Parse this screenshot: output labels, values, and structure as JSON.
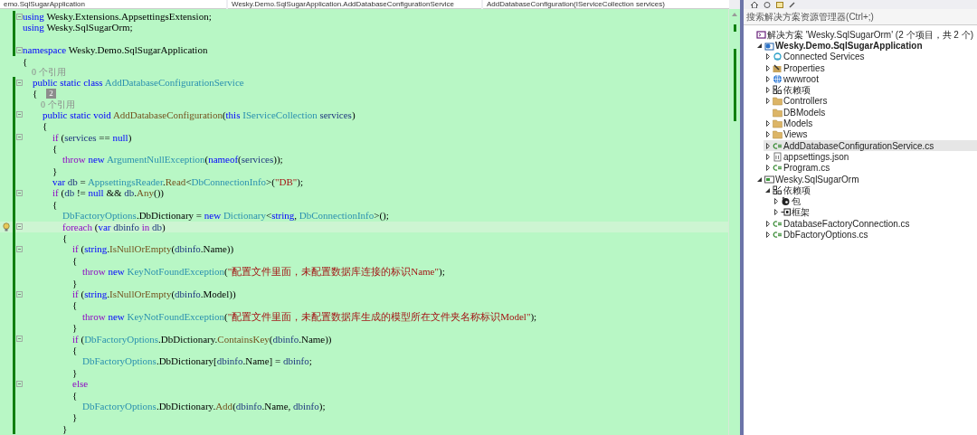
{
  "navigation_bar": [
    "emo.SqlSugarApplication",
    "Wesky.Demo.SqlSugarApplication.AddDatabaseConfigurationService",
    "AddDatabaseConfiguration(IServiceCollection services)"
  ],
  "editor": {
    "lines": [
      {
        "kind": "code",
        "changed": true,
        "foldable": true,
        "current": false,
        "tokens": [
          {
            "kind": "kw",
            "text": "using"
          },
          {
            "kind": "plain",
            "text": " Wesky.Extensions.AppsettingsExtension;"
          }
        ]
      },
      {
        "kind": "code",
        "changed": true,
        "foldable": false,
        "current": false,
        "tokens": [
          {
            "kind": "kw",
            "text": "using"
          },
          {
            "kind": "plain",
            "text": " Wesky.SqlSugarOrm;"
          }
        ]
      },
      {
        "kind": "blank",
        "changed": true,
        "foldable": false,
        "current": false
      },
      {
        "kind": "code",
        "changed": true,
        "foldable": true,
        "current": false,
        "tokens": [
          {
            "kind": "kw",
            "text": "namespace"
          },
          {
            "kind": "plain",
            "text": " Wesky.Demo.SqlSugarApplication"
          }
        ]
      },
      {
        "kind": "code",
        "changed": false,
        "foldable": false,
        "current": false,
        "tokens": [
          {
            "kind": "plain",
            "text": "{"
          }
        ]
      },
      {
        "kind": "codelens",
        "changed": false,
        "foldable": false,
        "current": false,
        "tokens": [
          {
            "kind": "lens",
            "text": "    0 个引用"
          }
        ]
      },
      {
        "kind": "code",
        "changed": true,
        "foldable": true,
        "current": false,
        "tokens": [
          {
            "kind": "kw",
            "text": "    public static class"
          },
          {
            "kind": "type",
            "text": " AddDatabaseConfigurationService"
          }
        ]
      },
      {
        "kind": "code",
        "changed": true,
        "foldable": false,
        "current": false,
        "tokens": [
          {
            "kind": "plain",
            "text": "    {"
          },
          {
            "kind": "badge",
            "text": "2"
          }
        ]
      },
      {
        "kind": "codelens",
        "changed": true,
        "foldable": false,
        "current": false,
        "tokens": [
          {
            "kind": "lens",
            "text": "        0 个引用"
          }
        ]
      },
      {
        "kind": "code",
        "changed": true,
        "foldable": true,
        "current": false,
        "tokens": [
          {
            "kind": "kw",
            "text": "        public static void"
          },
          {
            "kind": "method",
            "text": " AddDatabaseConfiguration"
          },
          {
            "kind": "plain",
            "text": "("
          },
          {
            "kind": "kw",
            "text": "this"
          },
          {
            "kind": "type",
            "text": " IServiceCollection"
          },
          {
            "kind": "ident",
            "text": " services"
          },
          {
            "kind": "plain",
            "text": ")"
          }
        ]
      },
      {
        "kind": "code",
        "changed": true,
        "foldable": false,
        "current": false,
        "tokens": [
          {
            "kind": "plain",
            "text": "        {"
          }
        ]
      },
      {
        "kind": "code",
        "changed": true,
        "foldable": true,
        "current": false,
        "tokens": [
          {
            "kind": "ctrl",
            "text": "            if"
          },
          {
            "kind": "plain",
            "text": " ("
          },
          {
            "kind": "ident",
            "text": "services"
          },
          {
            "kind": "plain",
            "text": " == "
          },
          {
            "kind": "kw",
            "text": "null"
          },
          {
            "kind": "plain",
            "text": ")"
          }
        ]
      },
      {
        "kind": "code",
        "changed": true,
        "foldable": false,
        "current": false,
        "tokens": [
          {
            "kind": "plain",
            "text": "            {"
          }
        ]
      },
      {
        "kind": "code",
        "changed": true,
        "foldable": false,
        "current": false,
        "tokens": [
          {
            "kind": "ctrl",
            "text": "                throw"
          },
          {
            "kind": "kw",
            "text": " new"
          },
          {
            "kind": "type",
            "text": " ArgumentNullException"
          },
          {
            "kind": "plain",
            "text": "("
          },
          {
            "kind": "kw",
            "text": "nameof"
          },
          {
            "kind": "plain",
            "text": "("
          },
          {
            "kind": "ident",
            "text": "services"
          },
          {
            "kind": "plain",
            "text": "));"
          }
        ]
      },
      {
        "kind": "code",
        "changed": true,
        "foldable": false,
        "current": false,
        "tokens": [
          {
            "kind": "plain",
            "text": "            }"
          }
        ]
      },
      {
        "kind": "code",
        "changed": true,
        "foldable": false,
        "current": false,
        "tokens": [
          {
            "kind": "kw",
            "text": "            var"
          },
          {
            "kind": "ident",
            "text": " db"
          },
          {
            "kind": "plain",
            "text": " = "
          },
          {
            "kind": "type",
            "text": "AppsettingsReader"
          },
          {
            "kind": "plain",
            "text": "."
          },
          {
            "kind": "method",
            "text": "Read"
          },
          {
            "kind": "plain",
            "text": "<"
          },
          {
            "kind": "type",
            "text": "DbConnectionInfo"
          },
          {
            "kind": "plain",
            "text": ">("
          },
          {
            "kind": "str",
            "text": "\"DB\""
          },
          {
            "kind": "plain",
            "text": ");"
          }
        ]
      },
      {
        "kind": "code",
        "changed": true,
        "foldable": true,
        "current": false,
        "tokens": [
          {
            "kind": "ctrl",
            "text": "            if"
          },
          {
            "kind": "plain",
            "text": " ("
          },
          {
            "kind": "ident",
            "text": "db"
          },
          {
            "kind": "plain",
            "text": " != "
          },
          {
            "kind": "kw",
            "text": "null"
          },
          {
            "kind": "plain",
            "text": " && "
          },
          {
            "kind": "ident",
            "text": "db"
          },
          {
            "kind": "plain",
            "text": "."
          },
          {
            "kind": "method",
            "text": "Any"
          },
          {
            "kind": "plain",
            "text": "())"
          }
        ]
      },
      {
        "kind": "code",
        "changed": true,
        "foldable": false,
        "current": false,
        "tokens": [
          {
            "kind": "plain",
            "text": "            {"
          }
        ]
      },
      {
        "kind": "code",
        "changed": true,
        "foldable": false,
        "current": false,
        "tokens": [
          {
            "kind": "type",
            "text": "                DbFactoryOptions"
          },
          {
            "kind": "plain",
            "text": ".DbDictionary = "
          },
          {
            "kind": "kw",
            "text": "new"
          },
          {
            "kind": "type",
            "text": " Dictionary"
          },
          {
            "kind": "plain",
            "text": "<"
          },
          {
            "kind": "kw",
            "text": "string"
          },
          {
            "kind": "plain",
            "text": ", "
          },
          {
            "kind": "type",
            "text": "DbConnectionInfo"
          },
          {
            "kind": "plain",
            "text": ">();"
          }
        ]
      },
      {
        "kind": "code",
        "changed": true,
        "foldable": true,
        "current": true,
        "tokens": [
          {
            "kind": "ctrl",
            "text": "                foreach"
          },
          {
            "kind": "plain",
            "text": " ("
          },
          {
            "kind": "kw",
            "text": "var"
          },
          {
            "kind": "ident",
            "text": " dbinfo"
          },
          {
            "kind": "ctrl",
            "text": " in"
          },
          {
            "kind": "ident",
            "text": " db"
          },
          {
            "kind": "plain",
            "text": ")"
          }
        ]
      },
      {
        "kind": "code",
        "changed": true,
        "foldable": false,
        "current": false,
        "tokens": [
          {
            "kind": "plain",
            "text": "                {"
          }
        ]
      },
      {
        "kind": "code",
        "changed": true,
        "foldable": true,
        "current": false,
        "tokens": [
          {
            "kind": "ctrl",
            "text": "                    if"
          },
          {
            "kind": "plain",
            "text": " ("
          },
          {
            "kind": "kw",
            "text": "string"
          },
          {
            "kind": "plain",
            "text": "."
          },
          {
            "kind": "method",
            "text": "IsNullOrEmpty"
          },
          {
            "kind": "plain",
            "text": "("
          },
          {
            "kind": "ident",
            "text": "dbinfo"
          },
          {
            "kind": "plain",
            "text": ".Name))"
          }
        ]
      },
      {
        "kind": "code",
        "changed": true,
        "foldable": false,
        "current": false,
        "tokens": [
          {
            "kind": "plain",
            "text": "                    {"
          }
        ]
      },
      {
        "kind": "code",
        "changed": true,
        "foldable": false,
        "current": false,
        "tokens": [
          {
            "kind": "ctrl",
            "text": "                        throw"
          },
          {
            "kind": "kw",
            "text": " new"
          },
          {
            "kind": "type",
            "text": " KeyNotFoundException"
          },
          {
            "kind": "plain",
            "text": "("
          },
          {
            "kind": "str",
            "text": "\"配置文件里面，未配置数据库连接的标识Name\""
          },
          {
            "kind": "plain",
            "text": ");"
          }
        ]
      },
      {
        "kind": "code",
        "changed": true,
        "foldable": false,
        "current": false,
        "tokens": [
          {
            "kind": "plain",
            "text": "                    }"
          }
        ]
      },
      {
        "kind": "code",
        "changed": true,
        "foldable": true,
        "current": false,
        "tokens": [
          {
            "kind": "ctrl",
            "text": "                    if"
          },
          {
            "kind": "plain",
            "text": " ("
          },
          {
            "kind": "kw",
            "text": "string"
          },
          {
            "kind": "plain",
            "text": "."
          },
          {
            "kind": "method",
            "text": "IsNullOrEmpty"
          },
          {
            "kind": "plain",
            "text": "("
          },
          {
            "kind": "ident",
            "text": "dbinfo"
          },
          {
            "kind": "plain",
            "text": ".Model))"
          }
        ]
      },
      {
        "kind": "code",
        "changed": true,
        "foldable": false,
        "current": false,
        "tokens": [
          {
            "kind": "plain",
            "text": "                    {"
          }
        ]
      },
      {
        "kind": "code",
        "changed": true,
        "foldable": false,
        "current": false,
        "tokens": [
          {
            "kind": "ctrl",
            "text": "                        throw"
          },
          {
            "kind": "kw",
            "text": " new"
          },
          {
            "kind": "type",
            "text": " KeyNotFoundException"
          },
          {
            "kind": "plain",
            "text": "("
          },
          {
            "kind": "str",
            "text": "\"配置文件里面，未配置数据库生成的模型所在文件夹名称标识Model\""
          },
          {
            "kind": "plain",
            "text": ");"
          }
        ]
      },
      {
        "kind": "code",
        "changed": true,
        "foldable": false,
        "current": false,
        "tokens": [
          {
            "kind": "plain",
            "text": "                    }"
          }
        ]
      },
      {
        "kind": "code",
        "changed": true,
        "foldable": true,
        "current": false,
        "tokens": [
          {
            "kind": "ctrl",
            "text": "                    if"
          },
          {
            "kind": "plain",
            "text": " ("
          },
          {
            "kind": "type",
            "text": "DbFactoryOptions"
          },
          {
            "kind": "plain",
            "text": ".DbDictionary."
          },
          {
            "kind": "method",
            "text": "ContainsKey"
          },
          {
            "kind": "plain",
            "text": "("
          },
          {
            "kind": "ident",
            "text": "dbinfo"
          },
          {
            "kind": "plain",
            "text": ".Name))"
          }
        ]
      },
      {
        "kind": "code",
        "changed": true,
        "foldable": false,
        "current": false,
        "tokens": [
          {
            "kind": "plain",
            "text": "                    {"
          }
        ]
      },
      {
        "kind": "code",
        "changed": true,
        "foldable": false,
        "current": false,
        "tokens": [
          {
            "kind": "type",
            "text": "                        DbFactoryOptions"
          },
          {
            "kind": "plain",
            "text": ".DbDictionary["
          },
          {
            "kind": "ident",
            "text": "dbinfo"
          },
          {
            "kind": "plain",
            "text": ".Name] = "
          },
          {
            "kind": "ident",
            "text": "dbinfo"
          },
          {
            "kind": "plain",
            "text": ";"
          }
        ]
      },
      {
        "kind": "code",
        "changed": true,
        "foldable": false,
        "current": false,
        "tokens": [
          {
            "kind": "plain",
            "text": "                    }"
          }
        ]
      },
      {
        "kind": "code",
        "changed": true,
        "foldable": true,
        "current": false,
        "tokens": [
          {
            "kind": "ctrl",
            "text": "                    else"
          }
        ]
      },
      {
        "kind": "code",
        "changed": true,
        "foldable": false,
        "current": false,
        "tokens": [
          {
            "kind": "plain",
            "text": "                    {"
          }
        ]
      },
      {
        "kind": "code",
        "changed": true,
        "foldable": false,
        "current": false,
        "tokens": [
          {
            "kind": "type",
            "text": "                        DbFactoryOptions"
          },
          {
            "kind": "plain",
            "text": ".DbDictionary."
          },
          {
            "kind": "method",
            "text": "Add"
          },
          {
            "kind": "plain",
            "text": "("
          },
          {
            "kind": "ident",
            "text": "dbinfo"
          },
          {
            "kind": "plain",
            "text": ".Name, "
          },
          {
            "kind": "ident",
            "text": "dbinfo"
          },
          {
            "kind": "plain",
            "text": ");"
          }
        ]
      },
      {
        "kind": "code",
        "changed": true,
        "foldable": false,
        "current": false,
        "tokens": [
          {
            "kind": "plain",
            "text": "                    }"
          }
        ]
      },
      {
        "kind": "code",
        "changed": true,
        "foldable": false,
        "current": false,
        "tokens": [
          {
            "kind": "plain",
            "text": "                }"
          }
        ]
      }
    ]
  },
  "solution_explorer": {
    "search": {
      "placeholder": "搜索解决方案资源管理器(Ctrl+;)"
    },
    "tree": [
      {
        "label": "解决方案 'Wesky.SqlSugarOrm' (2 个项目，共 2 个)",
        "kind": "solution",
        "bold": false,
        "selected": false,
        "children": [
          {
            "label": "Wesky.Demo.SqlSugarApplication",
            "kind": "project",
            "bold": true,
            "expanded": true,
            "selected": false,
            "children": [
              {
                "label": "Connected Services",
                "kind": "connected",
                "bold": false,
                "expanded": false,
                "selected": false
              },
              {
                "label": "Properties",
                "kind": "properties",
                "bold": false,
                "expanded": false,
                "selected": false
              },
              {
                "label": "wwwroot",
                "kind": "globe",
                "bold": false,
                "expanded": false,
                "selected": false
              },
              {
                "label": "依赖项",
                "kind": "deps",
                "bold": false,
                "expanded": false,
                "selected": false
              },
              {
                "label": "Controllers",
                "kind": "folder",
                "bold": false,
                "expanded": false,
                "selected": false
              },
              {
                "label": "DBModels",
                "kind": "folder",
                "bold": false,
                "selected": false
              },
              {
                "label": "Models",
                "kind": "folder",
                "bold": false,
                "expanded": false,
                "selected": false
              },
              {
                "label": "Views",
                "kind": "folder",
                "bold": false,
                "expanded": false,
                "selected": false
              },
              {
                "label": "AddDatabaseConfigurationService.cs",
                "kind": "cs",
                "bold": false,
                "expanded": false,
                "selected": true
              },
              {
                "label": "appsettings.json",
                "kind": "json",
                "bold": false,
                "expanded": false,
                "selected": false
              },
              {
                "label": "Program.cs",
                "kind": "cs",
                "bold": false,
                "expanded": false,
                "selected": false
              }
            ]
          },
          {
            "label": "Wesky.SqlSugarOrm",
            "kind": "library",
            "bold": false,
            "expanded": true,
            "selected": false,
            "children": [
              {
                "label": "依赖项",
                "kind": "deps",
                "bold": false,
                "expanded": true,
                "selected": false,
                "children": [
                  {
                    "label": "包",
                    "kind": "package",
                    "bold": false,
                    "expanded": false,
                    "selected": false
                  },
                  {
                    "label": "框架",
                    "kind": "framework",
                    "bold": false,
                    "expanded": false,
                    "selected": false
                  }
                ]
              },
              {
                "label": "DatabaseFactoryConnection.cs",
                "kind": "cs",
                "bold": false,
                "expanded": false,
                "selected": false
              },
              {
                "label": "DbFactoryOptions.cs",
                "kind": "cs",
                "bold": false,
                "expanded": false,
                "selected": false
              }
            ]
          }
        ]
      }
    ]
  }
}
